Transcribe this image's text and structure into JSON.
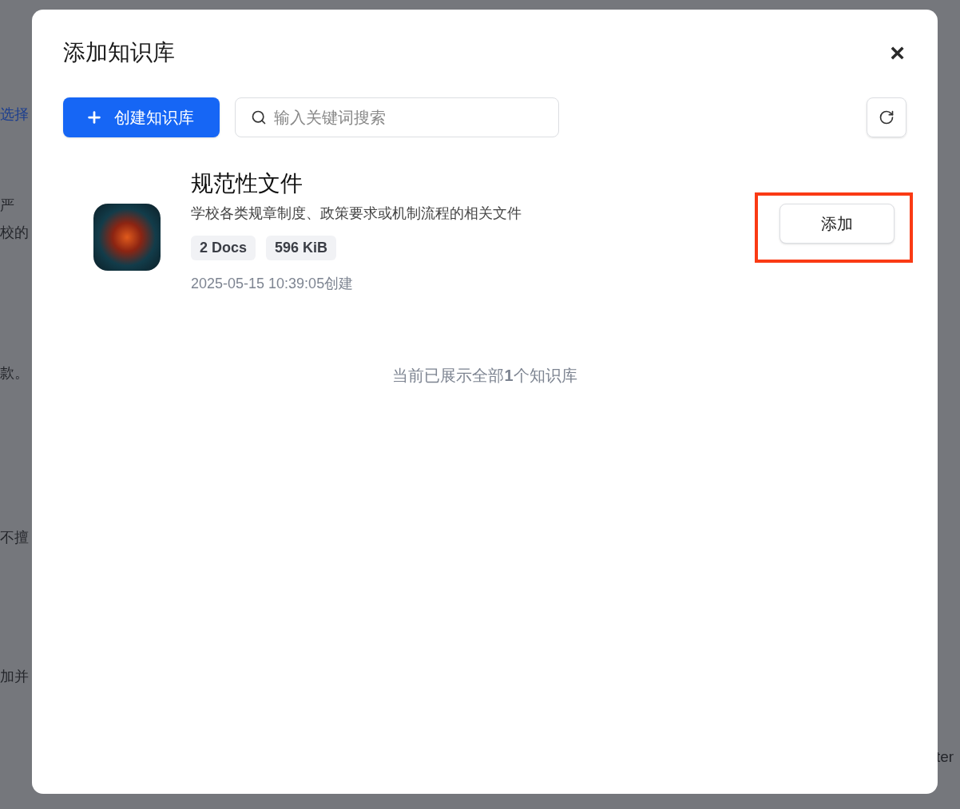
{
  "background": {
    "fragments": [
      {
        "text": "选择",
        "kind": "link"
      },
      {
        "text": "严",
        "kind": "text"
      },
      {
        "text": "校的",
        "kind": "text"
      },
      {
        "text": "款。",
        "kind": "text"
      },
      {
        "text": "不擅",
        "kind": "text"
      },
      {
        "text": "加并",
        "kind": "text"
      }
    ],
    "right_fragment": "ter"
  },
  "dialog": {
    "title": "添加知识库",
    "close": "×",
    "toolbar": {
      "create_button": "创建知识库",
      "search": {
        "placeholder": "输入关键词搜索"
      }
    },
    "knowledge_bases": [
      {
        "name": "规范性文件",
        "description": "学校各类规章制度、政策要求或机制流程的相关文件",
        "tags": [
          "2 Docs",
          "596 KiB"
        ],
        "created": "2025-05-15 10:39:05创建",
        "action": "添加",
        "highlighted": true
      }
    ],
    "summary": "当前已展示全部**1**个知识库"
  }
}
